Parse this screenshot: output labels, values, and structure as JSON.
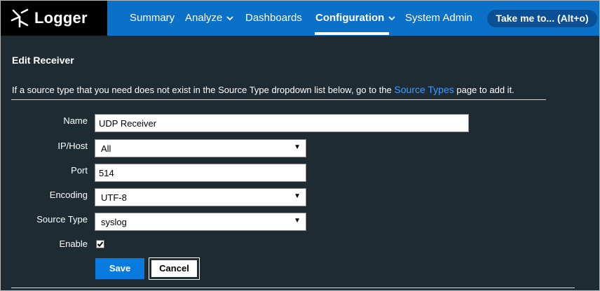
{
  "app": {
    "name": "Logger"
  },
  "nav": {
    "items": [
      "Summary",
      "Analyze",
      "Dashboards",
      "Configuration",
      "System Admin"
    ],
    "active": "Configuration",
    "take_me_to": "Take me to... (Alt+o)"
  },
  "page": {
    "title": "Edit Receiver",
    "info_prefix": "If a source type that you need does not exist in the Source Type dropdown list below, go to the",
    "info_link": "Source Types",
    "info_suffix": "page to add it."
  },
  "form": {
    "name": {
      "label": "Name",
      "value": "UDP Receiver"
    },
    "ip_host": {
      "label": "IP/Host",
      "selected": "All"
    },
    "port": {
      "label": "Port",
      "value": "514"
    },
    "encoding": {
      "label": "Encoding",
      "selected": "UTF-8"
    },
    "source_type": {
      "label": "Source Type",
      "selected": "syslog"
    },
    "enable": {
      "label": "Enable",
      "checked": true
    }
  },
  "buttons": {
    "save": "Save",
    "cancel": "Cancel"
  },
  "colors": {
    "nav_blue": "#0a70c8",
    "background": "#1f2b33",
    "link": "#3d9cff",
    "primary_button": "#0a7bde"
  }
}
